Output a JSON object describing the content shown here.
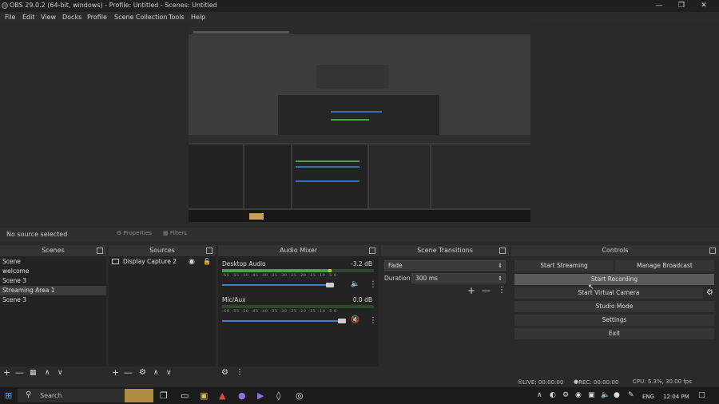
{
  "window": {
    "title": "OBS 29.0.2 (64-bit, windows) - Profile: Untitled - Scenes: Untitled",
    "min_icon": "minimize-icon",
    "max_icon": "maximize-icon",
    "close_icon": "close-icon"
  },
  "menu": [
    "File",
    "Edit",
    "View",
    "Docks",
    "Profile",
    "Scene Collection",
    "Tools",
    "Help"
  ],
  "context_bar": {
    "label": "No source selected",
    "properties": "Properties",
    "filters": "Filters"
  },
  "scenes": {
    "title": "Scenes",
    "items": [
      "Scene",
      "welcome",
      "Scene 3",
      "Streaming Area 1",
      "Scene 3"
    ],
    "selected_index": 3
  },
  "sources": {
    "title": "Sources",
    "items": [
      "Display Capture 2"
    ]
  },
  "audio_mixer": {
    "title": "Audio Mixer",
    "channels": [
      {
        "name": "Desktop Audio",
        "db": "-3.2 dB",
        "level": 0.72,
        "volume": 0.9
      },
      {
        "name": "Mic/Aux",
        "db": "0.0 dB",
        "level": 0.0,
        "volume": 1.0
      }
    ],
    "ticks": "-60 -55 -50 -45 -40 -35 -30 -25 -20 -15 -10 -5 0"
  },
  "scene_transitions": {
    "title": "Scene Transitions",
    "transition": "Fade",
    "duration_label": "Duration",
    "duration_value": "300 ms"
  },
  "controls": {
    "title": "Controls",
    "start_streaming": "Start Streaming",
    "manage_broadcast": "Manage Broadcast",
    "start_recording": "Start Recording",
    "start_virtual_camera": "Start Virtual Camera",
    "studio_mode": "Studio Mode",
    "settings": "Settings",
    "exit": "Exit"
  },
  "status": {
    "live": "LIVE: 00:00:00",
    "rec": "REC: 00:00:00",
    "cpu": "CPU: 5.3%, 30.00 fps"
  },
  "taskbar": {
    "search": "Search",
    "lang": "ENG",
    "time": "12:04 PM"
  },
  "colors": {
    "accent": "#3b7fd6",
    "meter_green": "#3fa83f",
    "meter_yellow": "#c8b93a",
    "meter_red": "#c84040"
  }
}
